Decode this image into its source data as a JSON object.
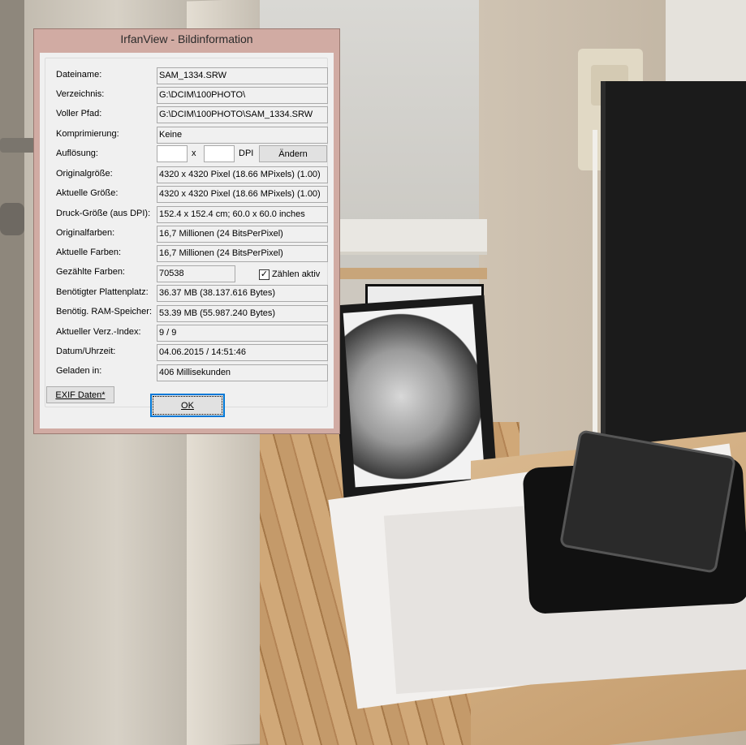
{
  "window": {
    "title": "IrfanView - Bildinformation"
  },
  "rows": [
    {
      "label": "Dateiname:",
      "value": "SAM_1334.SRW"
    },
    {
      "label": "Verzeichnis:",
      "value": "G:\\DCIM\\100PHOTO\\"
    },
    {
      "label": "Voller Pfad:",
      "value": "G:\\DCIM\\100PHOTO\\SAM_1334.SRW"
    },
    {
      "label": "Komprimierung:",
      "value": "Keine"
    },
    {
      "label": "Auflösung:",
      "value": ""
    },
    {
      "label": "Originalgröße:",
      "value": "4320 x 4320  Pixel (18.66 MPixels) (1.00)"
    },
    {
      "label": "Aktuelle Größe:",
      "value": "4320 x 4320  Pixel (18.66 MPixels) (1.00)"
    },
    {
      "label": "Druck-Größe (aus DPI):",
      "value": "152.4 x 152.4 cm; 60.0 x 60.0 inches"
    },
    {
      "label": "Originalfarben:",
      "value": "16,7 Millionen   (24 BitsPerPixel)"
    },
    {
      "label": "Aktuelle Farben:",
      "value": "16,7 Millionen   (24 BitsPerPixel)"
    },
    {
      "label": "Gezählte Farben:",
      "value": "70538"
    },
    {
      "label": "Benötigter Plattenplatz:",
      "value": "36.37 MB (38.137.616 Bytes)"
    },
    {
      "label": "Benötig. RAM-Speicher:",
      "value": "53.39  MB (55.987.240 Bytes)"
    },
    {
      "label": "Aktueller Verz.-Index:",
      "value": "9  /  9"
    },
    {
      "label": "Datum/Uhrzeit:",
      "value": "04.06.2015 / 14:51:46"
    },
    {
      "label": "Geladen in:",
      "value": "406 Millisekunden"
    }
  ],
  "resolution": {
    "x_value": "",
    "y_value": "",
    "separator": "x",
    "unit": "DPI",
    "change_button": "Ändern"
  },
  "count_colors": {
    "label": "Zählen aktiv",
    "checked": true,
    "mark": "✓"
  },
  "buttons": {
    "exif": "EXIF Daten*",
    "ok": "OK"
  }
}
